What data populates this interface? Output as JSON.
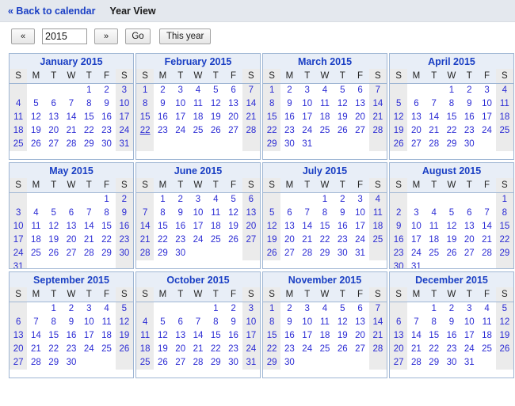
{
  "header": {
    "back_label": "« Back to calendar",
    "view_title": "Year View"
  },
  "toolbar": {
    "prev_label": "«",
    "next_label": "»",
    "year_value": "2015",
    "year_placeholder": "",
    "go_label": "Go",
    "this_year_label": "This year"
  },
  "weekday_headers": [
    "S",
    "M",
    "T",
    "W",
    "T",
    "F",
    "S"
  ],
  "colors": {
    "link": "#1a3fc4",
    "day_text": "#2b2bd4",
    "month_border": "#9fb6d4",
    "header_bg": "#e8eef7",
    "weekend_bg": "#ebebeb",
    "topbar_bg": "#e4e8ee"
  },
  "active_day": {
    "month": "February 2015",
    "day": "22"
  },
  "months": [
    {
      "title": "January 2015",
      "weeks": [
        [
          "",
          "",
          "",
          "",
          "1",
          "2",
          "3"
        ],
        [
          "4",
          "5",
          "6",
          "7",
          "8",
          "9",
          "10"
        ],
        [
          "11",
          "12",
          "13",
          "14",
          "15",
          "16",
          "17"
        ],
        [
          "18",
          "19",
          "20",
          "21",
          "22",
          "23",
          "24"
        ],
        [
          "25",
          "26",
          "27",
          "28",
          "29",
          "30",
          "31"
        ]
      ]
    },
    {
      "title": "February 2015",
      "weeks": [
        [
          "1",
          "2",
          "3",
          "4",
          "5",
          "6",
          "7"
        ],
        [
          "8",
          "9",
          "10",
          "11",
          "12",
          "13",
          "14"
        ],
        [
          "15",
          "16",
          "17",
          "18",
          "19",
          "20",
          "21"
        ],
        [
          "22",
          "23",
          "24",
          "25",
          "26",
          "27",
          "28"
        ],
        [
          "",
          "",
          "",
          "",
          "",
          "",
          ""
        ]
      ]
    },
    {
      "title": "March 2015",
      "weeks": [
        [
          "1",
          "2",
          "3",
          "4",
          "5",
          "6",
          "7"
        ],
        [
          "8",
          "9",
          "10",
          "11",
          "12",
          "13",
          "14"
        ],
        [
          "15",
          "16",
          "17",
          "18",
          "19",
          "20",
          "21"
        ],
        [
          "22",
          "23",
          "24",
          "25",
          "26",
          "27",
          "28"
        ],
        [
          "29",
          "30",
          "31",
          "",
          "",
          "",
          ""
        ]
      ]
    },
    {
      "title": "April 2015",
      "weeks": [
        [
          "",
          "",
          "",
          "1",
          "2",
          "3",
          "4"
        ],
        [
          "5",
          "6",
          "7",
          "8",
          "9",
          "10",
          "11"
        ],
        [
          "12",
          "13",
          "14",
          "15",
          "16",
          "17",
          "18"
        ],
        [
          "19",
          "20",
          "21",
          "22",
          "23",
          "24",
          "25"
        ],
        [
          "26",
          "27",
          "28",
          "29",
          "30",
          "",
          ""
        ]
      ]
    },
    {
      "title": "May 2015",
      "weeks": [
        [
          "",
          "",
          "",
          "",
          "",
          "1",
          "2"
        ],
        [
          "3",
          "4",
          "5",
          "6",
          "7",
          "8",
          "9"
        ],
        [
          "10",
          "11",
          "12",
          "13",
          "14",
          "15",
          "16"
        ],
        [
          "17",
          "18",
          "19",
          "20",
          "21",
          "22",
          "23"
        ],
        [
          "24",
          "25",
          "26",
          "27",
          "28",
          "29",
          "30"
        ],
        [
          "31",
          "",
          "",
          "",
          "",
          "",
          ""
        ]
      ]
    },
    {
      "title": "June 2015",
      "weeks": [
        [
          "",
          "1",
          "2",
          "3",
          "4",
          "5",
          "6"
        ],
        [
          "7",
          "8",
          "9",
          "10",
          "11",
          "12",
          "13"
        ],
        [
          "14",
          "15",
          "16",
          "17",
          "18",
          "19",
          "20"
        ],
        [
          "21",
          "22",
          "23",
          "24",
          "25",
          "26",
          "27"
        ],
        [
          "28",
          "29",
          "30",
          "",
          "",
          "",
          ""
        ]
      ]
    },
    {
      "title": "July 2015",
      "weeks": [
        [
          "",
          "",
          "",
          "1",
          "2",
          "3",
          "4"
        ],
        [
          "5",
          "6",
          "7",
          "8",
          "9",
          "10",
          "11"
        ],
        [
          "12",
          "13",
          "14",
          "15",
          "16",
          "17",
          "18"
        ],
        [
          "19",
          "20",
          "21",
          "22",
          "23",
          "24",
          "25"
        ],
        [
          "26",
          "27",
          "28",
          "29",
          "30",
          "31",
          ""
        ]
      ]
    },
    {
      "title": "August 2015",
      "weeks": [
        [
          "",
          "",
          "",
          "",
          "",
          "",
          "1"
        ],
        [
          "2",
          "3",
          "4",
          "5",
          "6",
          "7",
          "8"
        ],
        [
          "9",
          "10",
          "11",
          "12",
          "13",
          "14",
          "15"
        ],
        [
          "16",
          "17",
          "18",
          "19",
          "20",
          "21",
          "22"
        ],
        [
          "23",
          "24",
          "25",
          "26",
          "27",
          "28",
          "29"
        ],
        [
          "30",
          "31",
          "",
          "",
          "",
          "",
          ""
        ]
      ]
    },
    {
      "title": "September 2015",
      "weeks": [
        [
          "",
          "",
          "1",
          "2",
          "3",
          "4",
          "5"
        ],
        [
          "6",
          "7",
          "8",
          "9",
          "10",
          "11",
          "12"
        ],
        [
          "13",
          "14",
          "15",
          "16",
          "17",
          "18",
          "19"
        ],
        [
          "20",
          "21",
          "22",
          "23",
          "24",
          "25",
          "26"
        ],
        [
          "27",
          "28",
          "29",
          "30",
          "",
          "",
          ""
        ]
      ]
    },
    {
      "title": "October 2015",
      "weeks": [
        [
          "",
          "",
          "",
          "",
          "1",
          "2",
          "3"
        ],
        [
          "4",
          "5",
          "6",
          "7",
          "8",
          "9",
          "10"
        ],
        [
          "11",
          "12",
          "13",
          "14",
          "15",
          "16",
          "17"
        ],
        [
          "18",
          "19",
          "20",
          "21",
          "22",
          "23",
          "24"
        ],
        [
          "25",
          "26",
          "27",
          "28",
          "29",
          "30",
          "31"
        ]
      ]
    },
    {
      "title": "November 2015",
      "weeks": [
        [
          "1",
          "2",
          "3",
          "4",
          "5",
          "6",
          "7"
        ],
        [
          "8",
          "9",
          "10",
          "11",
          "12",
          "13",
          "14"
        ],
        [
          "15",
          "16",
          "17",
          "18",
          "19",
          "20",
          "21"
        ],
        [
          "22",
          "23",
          "24",
          "25",
          "26",
          "27",
          "28"
        ],
        [
          "29",
          "30",
          "",
          "",
          "",
          "",
          ""
        ]
      ]
    },
    {
      "title": "December 2015",
      "weeks": [
        [
          "",
          "",
          "1",
          "2",
          "3",
          "4",
          "5"
        ],
        [
          "6",
          "7",
          "8",
          "9",
          "10",
          "11",
          "12"
        ],
        [
          "13",
          "14",
          "15",
          "16",
          "17",
          "18",
          "19"
        ],
        [
          "20",
          "21",
          "22",
          "23",
          "24",
          "25",
          "26"
        ],
        [
          "27",
          "28",
          "29",
          "30",
          "31",
          "",
          ""
        ]
      ]
    }
  ]
}
